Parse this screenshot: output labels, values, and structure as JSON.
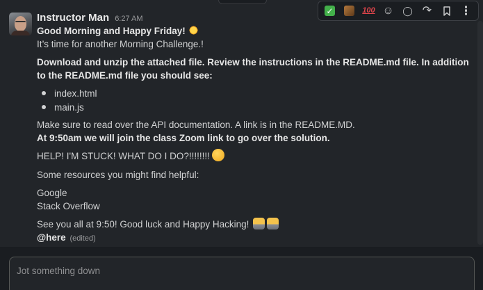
{
  "message": {
    "author": "Instructor Man",
    "time": "6:27 AM",
    "greeting": "Good Morning and Happy Friday!",
    "line_challenge": "It’s time for another Morning Challenge.!",
    "instructions": "Download and unzip the attached file. Review the instructions in the README.md file. In addition to the README.md file you should see:",
    "files": [
      "index.html",
      "main.js"
    ],
    "api_note": "Make sure to read over the API documentation.  A link is in the README.MD.",
    "zoom_note": "At 9:50am we will join the class Zoom link to go over the solution.",
    "help_text": "HELP! I'M STUCK! WHAT DO I DO?!!!!!!!!",
    "resources_intro": "Some resources you might find helpful:",
    "resources": [
      "Google",
      "Stack Overflow"
    ],
    "signoff": "See you all at 9:50! Good luck and Happy Hacking!",
    "mention": "@here",
    "edited_label": "(edited)",
    "emojis": {
      "greeting": "sun-emoji",
      "help": "thinking-face-emoji",
      "signoff": "technologist-emoji"
    }
  },
  "toolbar": {
    "items": [
      {
        "name": "white-check-mark-reaction",
        "glyph": "✓"
      },
      {
        "name": "custom-reaction"
      },
      {
        "name": "hundred-reaction",
        "glyph": "100"
      },
      {
        "name": "add-reaction-icon",
        "glyph": "☺"
      },
      {
        "name": "reply-in-thread-icon",
        "glyph": "◯"
      },
      {
        "name": "share-message-icon",
        "glyph": "↷"
      },
      {
        "name": "save-bookmark-icon",
        "glyph": "⎓"
      },
      {
        "name": "more-actions-icon",
        "glyph": "⋮"
      }
    ]
  },
  "composer": {
    "placeholder": "Jot something down",
    "value": ""
  },
  "colors": {
    "background": "#1a1d21",
    "message_bg": "#222529",
    "text": "#d1d2d3",
    "muted": "#9a9b9d",
    "check_green": "#43b04a",
    "hundred_red": "#e0454b"
  }
}
